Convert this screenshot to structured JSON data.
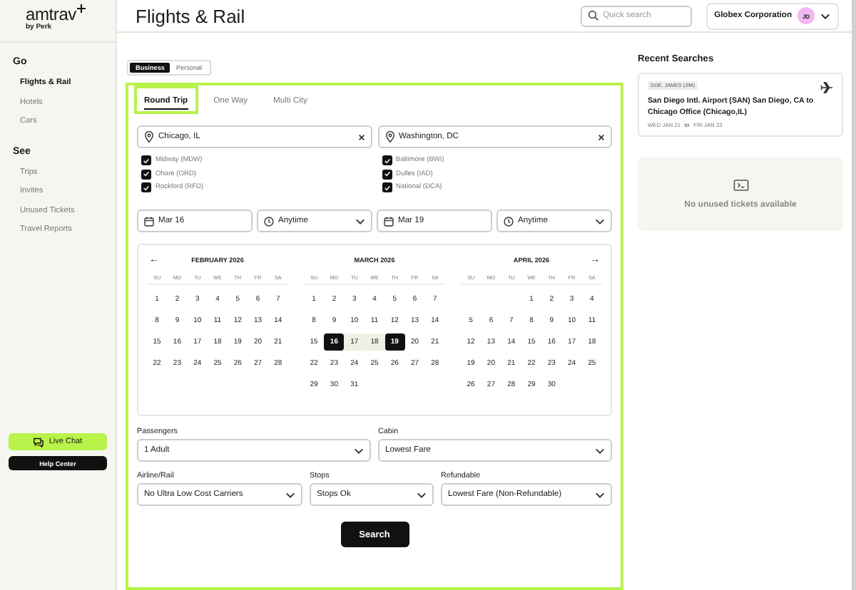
{
  "sidebar": {
    "logo": "amtrav",
    "logo_sub": "by Perk",
    "sections": [
      {
        "title": "Go",
        "items": [
          {
            "label": "Flights & Rail",
            "selected": true
          },
          {
            "label": "Hotels",
            "selected": false
          },
          {
            "label": "Cars",
            "selected": false
          }
        ]
      },
      {
        "title": "See",
        "items": [
          {
            "label": "Trips",
            "selected": false
          },
          {
            "label": "Invites",
            "selected": false
          },
          {
            "label": "Unused Tickets",
            "selected": false
          },
          {
            "label": "Travel Reports",
            "selected": false
          }
        ]
      }
    ],
    "live_chat": "Live Chat",
    "help_center": "Help Center"
  },
  "header": {
    "title": "Flights & Rail",
    "search": {
      "placeholder": "Quick search"
    },
    "company": "Globex Corporation",
    "avatar": "JD"
  },
  "trip_type": [
    {
      "label": "Business",
      "selected": true
    },
    {
      "label": "Personal",
      "selected": false
    }
  ],
  "tabs": [
    {
      "label": "Round Trip",
      "selected": true
    },
    {
      "label": "One Way",
      "selected": false
    },
    {
      "label": "Multi City",
      "selected": false
    }
  ],
  "locations": [
    {
      "value": "Chicago, IL",
      "airports": [
        {
          "label": "Midway (MDW)",
          "checked": true
        },
        {
          "label": "Ohare (ORD)",
          "checked": true
        },
        {
          "label": "Rockford (RFD)",
          "checked": true
        }
      ]
    },
    {
      "value": "Washington, DC",
      "airports": [
        {
          "label": "Baltimore (BWI)",
          "checked": true
        },
        {
          "label": "Dulles (IAD)",
          "checked": true
        },
        {
          "label": "National (DCA)",
          "checked": true
        }
      ]
    }
  ],
  "dates": [
    {
      "date": "Mar 16",
      "time": "Anytime"
    },
    {
      "date": "Mar 19",
      "time": "Anytime"
    }
  ],
  "calendar": {
    "prev": "←",
    "next": "→",
    "months": [
      {
        "title": "FEBRUARY 2026",
        "weekdays": [
          "SU",
          "MO",
          "TU",
          "WE",
          "TH",
          "FR",
          "SA"
        ],
        "weeks": [
          {
            "kind": "full",
            "days": [
              {
                "day": "1",
                "selected": false,
                "in_range": false
              },
              {
                "day": "2",
                "selected": false,
                "in_range": false
              },
              {
                "day": "3",
                "selected": false,
                "in_range": false
              },
              {
                "day": "4",
                "selected": false,
                "in_range": false
              },
              {
                "day": "5",
                "selected": false,
                "in_range": false
              },
              {
                "day": "6",
                "selected": false,
                "in_range": false
              },
              {
                "day": "7",
                "selected": false,
                "in_range": false
              }
            ]
          },
          {
            "kind": "full",
            "days": [
              {
                "day": "8",
                "selected": false,
                "in_range": false
              },
              {
                "day": "9",
                "selected": false,
                "in_range": false
              },
              {
                "day": "10",
                "selected": false,
                "in_range": false
              },
              {
                "day": "11",
                "selected": false,
                "in_range": false
              },
              {
                "day": "12",
                "selected": false,
                "in_range": false
              },
              {
                "day": "13",
                "selected": false,
                "in_range": false
              },
              {
                "day": "14",
                "selected": false,
                "in_range": false
              }
            ]
          },
          {
            "kind": "full",
            "days": [
              {
                "day": "15",
                "selected": false,
                "in_range": false
              },
              {
                "day": "16",
                "selected": false,
                "in_range": false
              },
              {
                "day": "17",
                "selected": false,
                "in_range": false
              },
              {
                "day": "18",
                "selected": false,
                "in_range": false
              },
              {
                "day": "19",
                "selected": false,
                "in_range": false
              },
              {
                "day": "20",
                "selected": false,
                "in_range": false
              },
              {
                "day": "21",
                "selected": false,
                "in_range": false
              }
            ]
          },
          {
            "kind": "full",
            "days": [
              {
                "day": "22",
                "selected": false,
                "in_range": false
              },
              {
                "day": "23",
                "selected": false,
                "in_range": false
              },
              {
                "day": "24",
                "selected": false,
                "in_range": false
              },
              {
                "day": "25",
                "selected": false,
                "in_range": false
              },
              {
                "day": "26",
                "selected": false,
                "in_range": false
              },
              {
                "day": "27",
                "selected": false,
                "in_range": false
              },
              {
                "day": "28",
                "selected": false,
                "in_range": false
              }
            ]
          }
        ]
      },
      {
        "title": "MARCH 2026",
        "weekdays": [
          "SU",
          "MO",
          "TU",
          "WE",
          "TH",
          "FR",
          "SA"
        ],
        "weeks": [
          {
            "kind": "full",
            "days": [
              {
                "day": "1",
                "selected": false,
                "in_range": false
              },
              {
                "day": "2",
                "selected": false,
                "in_range": false
              },
              {
                "day": "3",
                "selected": false,
                "in_range": false
              },
              {
                "day": "4",
                "selected": false,
                "in_range": false
              },
              {
                "day": "5",
                "selected": false,
                "in_range": false
              },
              {
                "day": "6",
                "selected": false,
                "in_range": false
              },
              {
                "day": "7",
                "selected": false,
                "in_range": false
              }
            ]
          },
          {
            "kind": "full",
            "days": [
              {
                "day": "8",
                "selected": false,
                "in_range": false
              },
              {
                "day": "9",
                "selected": false,
                "in_range": false
              },
              {
                "day": "10",
                "selected": false,
                "in_range": false
              },
              {
                "day": "11",
                "selected": false,
                "in_range": false
              },
              {
                "day": "12",
                "selected": false,
                "in_range": false
              },
              {
                "day": "13",
                "selected": false,
                "in_range": false
              },
              {
                "day": "14",
                "selected": false,
                "in_range": false
              }
            ]
          },
          {
            "kind": "full",
            "days": [
              {
                "day": "15",
                "selected": false,
                "in_range": false
              },
              {
                "day": "16",
                "selected": true,
                "in_range": false
              },
              {
                "day": "17",
                "selected": false,
                "in_range": true
              },
              {
                "day": "18",
                "selected": false,
                "in_range": true
              },
              {
                "day": "19",
                "selected": true,
                "in_range": false
              },
              {
                "day": "20",
                "selected": false,
                "in_range": false
              },
              {
                "day": "21",
                "selected": false,
                "in_range": false
              }
            ]
          },
          {
            "kind": "full",
            "days": [
              {
                "day": "22",
                "selected": false,
                "in_range": false
              },
              {
                "day": "23",
                "selected": false,
                "in_range": false
              },
              {
                "day": "24",
                "selected": false,
                "in_range": false
              },
              {
                "day": "25",
                "selected": false,
                "in_range": false
              },
              {
                "day": "26",
                "selected": false,
                "in_range": false
              },
              {
                "day": "27",
                "selected": false,
                "in_range": false
              },
              {
                "day": "28",
                "selected": false,
                "in_range": false
              }
            ]
          },
          {
            "kind": "end_partial",
            "days": [
              {
                "day": "29",
                "selected": false,
                "in_range": false
              },
              {
                "day": "30",
                "selected": false,
                "in_range": false
              },
              {
                "day": "31",
                "selected": false,
                "in_range": false
              }
            ]
          }
        ]
      },
      {
        "title": "APRIL 2026",
        "weekdays": [
          "SU",
          "MO",
          "TU",
          "WE",
          "TH",
          "FR",
          "SA"
        ],
        "weeks": [
          {
            "kind": "start_partial",
            "days": [
              {
                "day": "1",
                "selected": false,
                "in_range": false
              },
              {
                "day": "2",
                "selected": false,
                "in_range": false
              },
              {
                "day": "3",
                "selected": false,
                "in_range": false
              },
              {
                "day": "4",
                "selected": false,
                "in_range": false
              }
            ]
          },
          {
            "kind": "full",
            "days": [
              {
                "day": "5",
                "selected": false,
                "in_range": false
              },
              {
                "day": "6",
                "selected": false,
                "in_range": false
              },
              {
                "day": "7",
                "selected": false,
                "in_range": false
              },
              {
                "day": "8",
                "selected": false,
                "in_range": false
              },
              {
                "day": "9",
                "selected": false,
                "in_range": false
              },
              {
                "day": "10",
                "selected": false,
                "in_range": false
              },
              {
                "day": "11",
                "selected": false,
                "in_range": false
              }
            ]
          },
          {
            "kind": "full",
            "days": [
              {
                "day": "12",
                "selected": false,
                "in_range": false
              },
              {
                "day": "13",
                "selected": false,
                "in_range": false
              },
              {
                "day": "14",
                "selected": false,
                "in_range": false
              },
              {
                "day": "15",
                "selected": false,
                "in_range": false
              },
              {
                "day": "16",
                "selected": false,
                "in_range": false
              },
              {
                "day": "17",
                "selected": false,
                "in_range": false
              },
              {
                "day": "18",
                "selected": false,
                "in_range": false
              }
            ]
          },
          {
            "kind": "full",
            "days": [
              {
                "day": "19",
                "selected": false,
                "in_range": false
              },
              {
                "day": "20",
                "selected": false,
                "in_range": false
              },
              {
                "day": "21",
                "selected": false,
                "in_range": false
              },
              {
                "day": "22",
                "selected": false,
                "in_range": false
              },
              {
                "day": "23",
                "selected": false,
                "in_range": false
              },
              {
                "day": "24",
                "selected": false,
                "in_range": false
              },
              {
                "day": "25",
                "selected": false,
                "in_range": false
              }
            ]
          },
          {
            "kind": "end_partial",
            "days": [
              {
                "day": "26",
                "selected": false,
                "in_range": false
              },
              {
                "day": "27",
                "selected": false,
                "in_range": false
              },
              {
                "day": "28",
                "selected": false,
                "in_range": false
              },
              {
                "day": "29",
                "selected": false,
                "in_range": false
              },
              {
                "day": "30",
                "selected": false,
                "in_range": false
              }
            ]
          }
        ]
      }
    ]
  },
  "options_row1": [
    {
      "label": "Passengers",
      "value": "1 Adult"
    },
    {
      "label": "Cabin",
      "value": "Lowest Fare"
    }
  ],
  "options_row2": [
    {
      "label": "Airline/Rail",
      "value": "No Ultra Low Cost Carriers"
    },
    {
      "label": "Stops",
      "value": "Stops Ok"
    },
    {
      "label": "Refundable",
      "value": "Lowest Fare (Non-Refundable)"
    }
  ],
  "search_button": "Search",
  "recent": {
    "title": "Recent Searches",
    "items": [
      {
        "traveler": "DOE, JAMES (JIM)",
        "route": "San Diego Intl. Airport (SAN) San Diego, CA to Chicago Office (Chicago,IL)",
        "depart": "WED JAN 21",
        "to": "to",
        "return": "FRI JAN 23"
      }
    ]
  },
  "unused": {
    "message": "No unused tickets available"
  }
}
